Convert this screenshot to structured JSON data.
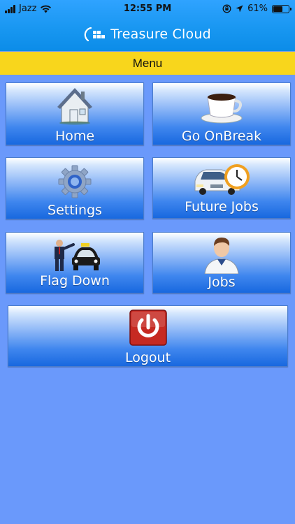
{
  "status_bar": {
    "carrier": "Jazz",
    "time": "12:55 PM",
    "battery_percent": "61%",
    "battery_level": 0.61,
    "icons": [
      "signal-icon",
      "wifi-icon",
      "orientation-lock-icon",
      "location-icon",
      "battery-icon"
    ]
  },
  "app": {
    "logo_text": "Treasure Cloud",
    "header_color": "#1796f0"
  },
  "menu_bar": {
    "title": "Menu",
    "color": "#f8d61c"
  },
  "tiles": [
    {
      "label": "Home",
      "icon": "house-icon"
    },
    {
      "label": "Go OnBreak",
      "icon": "coffee-cup-icon"
    },
    {
      "label": "Settings",
      "icon": "gear-icon"
    },
    {
      "label": "Future Jobs",
      "icon": "car-clock-icon"
    },
    {
      "label": "Flag Down",
      "icon": "man-hailing-taxi-icon"
    },
    {
      "label": "Jobs",
      "icon": "person-icon"
    },
    {
      "label": "Logout",
      "icon": "power-icon"
    }
  ],
  "background_color": "#6a99fb"
}
